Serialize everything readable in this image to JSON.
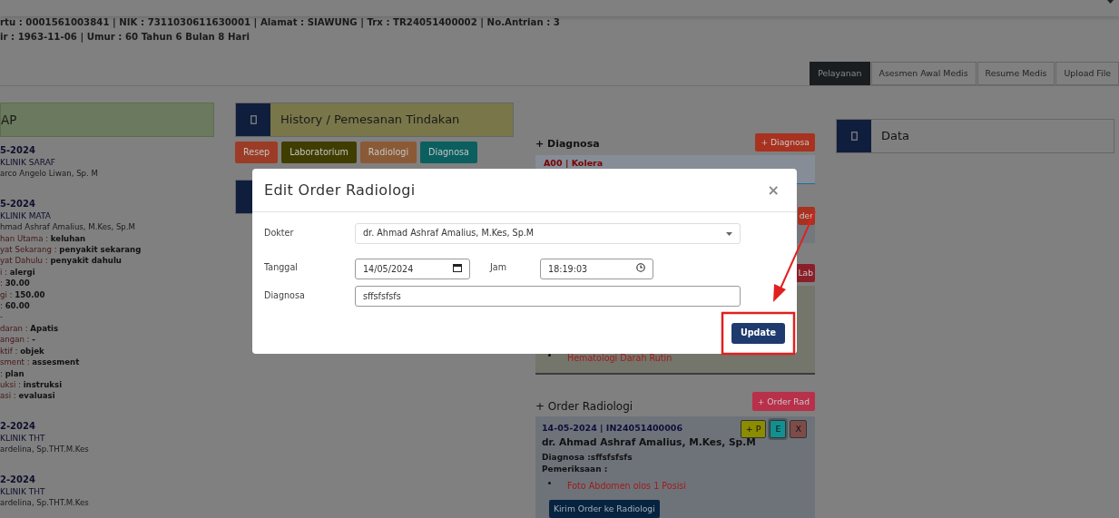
{
  "header": {
    "info_lines": [
      "rtu : 0001561003841 | NIK : 7311030611630001 | Alamat : SIAWUNG | Trx : TR24051400002 | No.Antrian : 3",
      "ir : 1963-11-06 | Umur : 60 Tahun 6 Bulan 8 Hari"
    ]
  },
  "tabs": [
    {
      "label": "Pelayanan",
      "selected": true
    },
    {
      "label": "Asesmen Awal Medis",
      "selected": false
    },
    {
      "label": "Resume Medis",
      "selected": false
    },
    {
      "label": "Upload File",
      "selected": false
    }
  ],
  "soap_panel": {
    "title": "AP",
    "entries": [
      {
        "date": "5-2024",
        "clinic": "KLINIK SARAF",
        "doctor": "arco Angelo Liwan, Sp. M"
      },
      {
        "date": "5-2024",
        "clinic": "KLINIK MATA",
        "doctor": "hmad Ashraf Amalius, M.Kes, Sp.M",
        "details": [
          "han Utama : **keluhan**",
          "yat Sekarang : **penyakit sekarang**",
          "yat Dahulu : **penyakit dahulu**",
          "i : **alergi**",
          ": **30.00**",
          "gi : **150.00**",
          ": **60.00**",
          "-",
          "daran : **Apatis**",
          "angan : **-**",
          "ktif : **objek**",
          "sment : **assesment**",
          ": **plan**",
          "uksi : **instruksi**",
          "asi : **evaluasi**"
        ]
      },
      {
        "date": "2-2024",
        "clinic": "KLINIK THT",
        "doctor": "ardelina, Sp.THT.M.Kes"
      },
      {
        "date": "2-2024",
        "clinic": "KLINIK THT",
        "doctor": "ardelina, Sp.THT.M.Kes"
      }
    ]
  },
  "history_panel": {
    "title": "History / Pemesanan Tindakan",
    "buttons": [
      {
        "label": "Resep",
        "color": "#9c3b26"
      },
      {
        "label": "Laboratorium",
        "color": "#403d00"
      },
      {
        "label": "Radiologi",
        "color": "#8a5a36"
      },
      {
        "label": "Diagnosa",
        "color": "#0b5f5f"
      }
    ]
  },
  "diagnosa": {
    "title": "+ Diagnosa",
    "add_button": "+ Diagnosa",
    "items": [
      "A00 | Kolera"
    ]
  },
  "order_section": {
    "button": "der"
  },
  "lab_section": {
    "button": "Lab",
    "items": [
      "Hematologi Darah Rutin"
    ]
  },
  "radiology": {
    "title": "+ Order Radiologi",
    "add_button": "+ Order Rad",
    "orders": [
      {
        "header": "14-05-2024 | IN24051400006",
        "actions": [
          {
            "label": "+ P",
            "color": "#8c8c00"
          },
          {
            "label": "E",
            "color": "#129090"
          },
          {
            "label": "X",
            "color": "#7e4c48"
          }
        ],
        "doctor": "dr. Ahmad Ashraf Amalius, M.Kes, Sp.M",
        "diagnosa": "Diagnosa :sffsfsfsfs",
        "exam_label": "Pemeriksaan :",
        "items": [
          "Foto Abdomen olos 1 Posisi"
        ],
        "send_button": "Kirim Order ke Radiologi"
      }
    ]
  },
  "data_panel": {
    "title": "Data"
  },
  "modal": {
    "title": "Edit Order Radiologi",
    "close": "×",
    "dokter": {
      "label": "Dokter",
      "value": "dr. Ahmad Ashraf Amalius, M.Kes, Sp.M"
    },
    "tanggal": {
      "label": "Tanggal",
      "value": "14/05/2024"
    },
    "jam": {
      "label": "Jam",
      "value": "18:19:03"
    },
    "diagnosa": {
      "label": "Diagnosa",
      "value": "sffsfsfsfs"
    },
    "submit": "Update"
  }
}
